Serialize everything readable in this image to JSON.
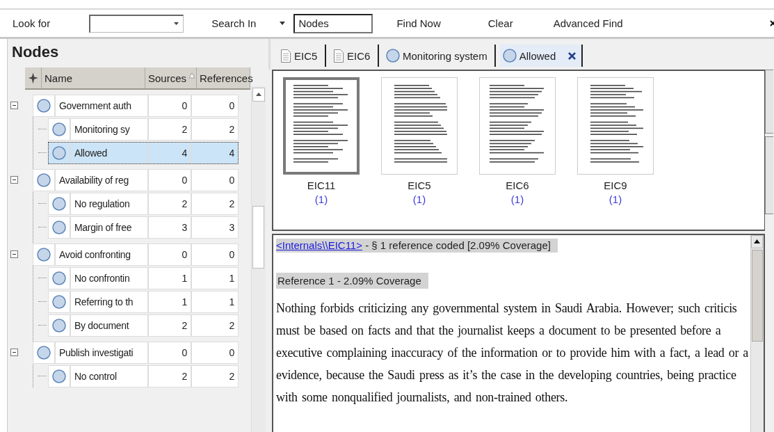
{
  "find_bar": {
    "look_for_label": "Look for",
    "search_in_label": "Search In",
    "search_in_field": {
      "value": "Nodes"
    },
    "buttons": [
      "Find Now",
      "Clear",
      "Advanced Find"
    ]
  },
  "nodes_panel": {
    "title": "Nodes",
    "columns": [
      {
        "label": "Name",
        "sorted": false
      },
      {
        "label": "Sources",
        "sorted": true
      },
      {
        "label": "References",
        "sorted": false
      }
    ],
    "rows": [
      {
        "name": "Government auth",
        "sources": "0",
        "references": "0",
        "selected": false,
        "expanded": true,
        "children": [
          {
            "name": "Monitoring sy",
            "sources": "2",
            "references": "2",
            "selected": false
          },
          {
            "name": "Allowed",
            "sources": "4",
            "references": "4",
            "selected": true
          }
        ]
      },
      {
        "name": "Availability of reg",
        "sources": "0",
        "references": "0",
        "selected": false,
        "expanded": true,
        "children": [
          {
            "name": "No regulation",
            "sources": "2",
            "references": "2",
            "selected": false
          },
          {
            "name": "Margin of free",
            "sources": "3",
            "references": "3",
            "selected": false
          }
        ]
      },
      {
        "name": "Avoid confronting",
        "sources": "0",
        "references": "0",
        "selected": false,
        "expanded": true,
        "children": [
          {
            "name": "No confrontin",
            "sources": "1",
            "references": "1",
            "selected": false
          },
          {
            "name": "Referring to th",
            "sources": "1",
            "references": "1",
            "selected": false
          },
          {
            "name": "By document",
            "sources": "2",
            "references": "2",
            "selected": false
          }
        ]
      },
      {
        "name": "Publish investigati",
        "sources": "0",
        "references": "0",
        "selected": false,
        "expanded": true,
        "children": [
          {
            "name": "No control",
            "sources": "2",
            "references": "2",
            "selected": false
          }
        ]
      }
    ]
  },
  "tabs": [
    {
      "label": "EIC5",
      "kind": "document",
      "selected": false
    },
    {
      "label": "EIC6",
      "kind": "document",
      "selected": false
    },
    {
      "label": "Monitoring system",
      "kind": "node",
      "selected": false
    },
    {
      "label": "Allowed",
      "kind": "node",
      "selected": true
    }
  ],
  "thumbnails": [
    {
      "name": "EIC11",
      "count": "(1)",
      "selected": true
    },
    {
      "name": "EIC5",
      "count": "(1)",
      "selected": false
    },
    {
      "name": "EIC6",
      "count": "(1)",
      "selected": false
    },
    {
      "name": "EIC9",
      "count": "(1)",
      "selected": false
    }
  ],
  "reference_view": {
    "source_link": "<Internals\\\\EIC11>",
    "source_summary": " - § 1 reference coded  [2.09% Coverage]",
    "reference_label": "Reference 1 - 2.09% Coverage",
    "paragraph_lines": [
      "Nothing forbids criticizing any governmental system in Saudi Arabia. However; such criticis",
      "must be based on facts and that the journalist keeps a document to be presented before a",
      "executive complaining inaccuracy of the information or to provide him with a fact, a lead or a",
      "evidence, because the Saudi press as it’s the case in the developing countries, being practice",
      "with some nonqualified journalists, and non-trained others."
    ]
  }
}
